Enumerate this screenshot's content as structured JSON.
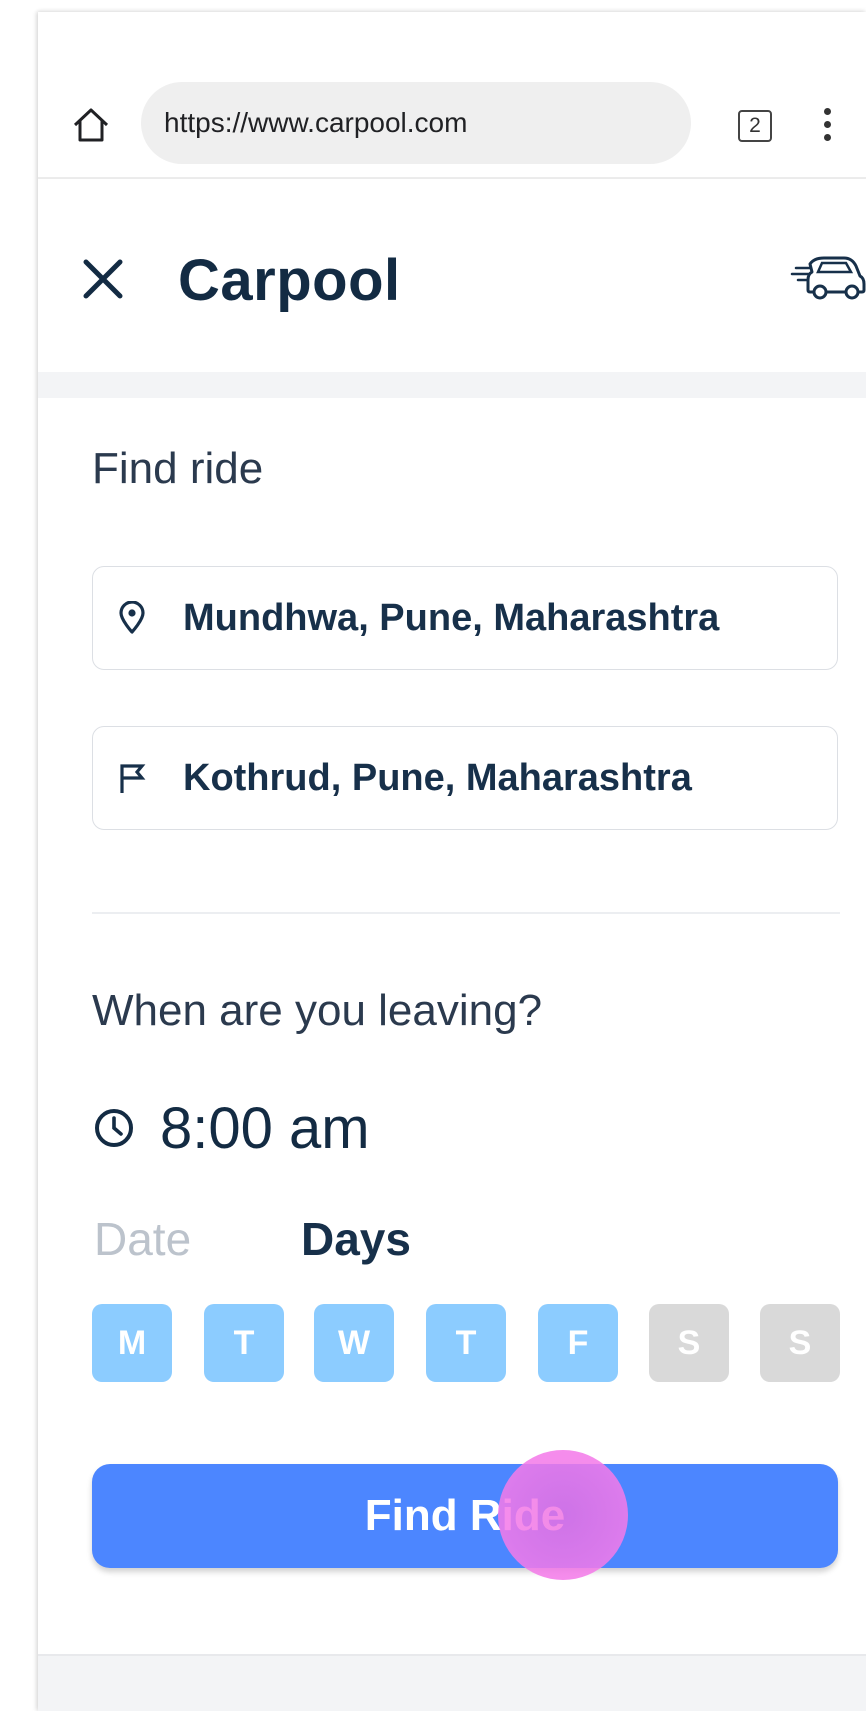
{
  "browser": {
    "url": "https://www.carpool.com",
    "tab_count": "2"
  },
  "header": {
    "title": "Carpool"
  },
  "find_ride": {
    "section_label": "Find ride",
    "from_value": "Mundhwa, Pune, Maharashtra",
    "to_value": "Kothrud, Pune, Maharashtra"
  },
  "schedule": {
    "question": "When are you leaving?",
    "time": "8:00 am",
    "mode_options": [
      "Date",
      "Days"
    ],
    "selected_mode": "Days",
    "days": [
      {
        "label": "M",
        "selected": true
      },
      {
        "label": "T",
        "selected": true
      },
      {
        "label": "W",
        "selected": true
      },
      {
        "label": "T",
        "selected": true
      },
      {
        "label": "F",
        "selected": true
      },
      {
        "label": "S",
        "selected": false
      },
      {
        "label": "S",
        "selected": false
      }
    ]
  },
  "action": {
    "button_label": "Find Ride"
  },
  "icons": {
    "home": "home-icon",
    "tabs": "tabs-icon",
    "menu": "more-vert-icon",
    "close": "close-icon",
    "car": "car-icon",
    "from": "location-pin-icon",
    "to": "flag-icon",
    "time": "clock-icon"
  },
  "colors": {
    "title_text": "#132b43",
    "primary_button": "#4c86ff",
    "day_selected": "#8cccff",
    "day_unselected": "#d9d9d9",
    "inactive_tab_text": "#bcc3cc"
  }
}
